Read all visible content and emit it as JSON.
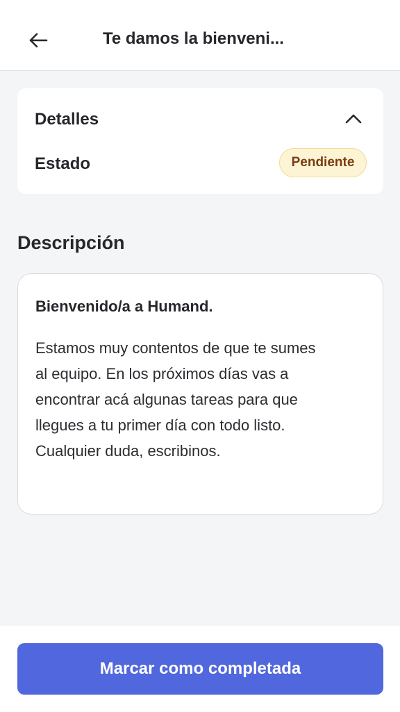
{
  "header": {
    "title": "Te damos la bienveni...",
    "back_icon": "arrow-left-icon"
  },
  "details": {
    "title": "Detalles",
    "toggle_icon": "chevron-up-icon",
    "status_label": "Estado",
    "status_value": "Pendiente"
  },
  "description": {
    "heading": "Descripción",
    "title": "Bienvenido/a a Humand.",
    "lines": [
      "Estamos muy contentos de que te sumes",
      "al equipo. En los próximos días vas a",
      "encontrar acá algunas tareas para que",
      "llegues a tu primer día con todo listo.",
      "Cualquier duda, escribinos."
    ]
  },
  "footer": {
    "primary_button": "Marcar como completada"
  },
  "colors": {
    "accent": "#5067dd",
    "background": "#f4f5f7",
    "badge_bg": "#fdf4d6",
    "badge_text": "#7a3d12"
  }
}
